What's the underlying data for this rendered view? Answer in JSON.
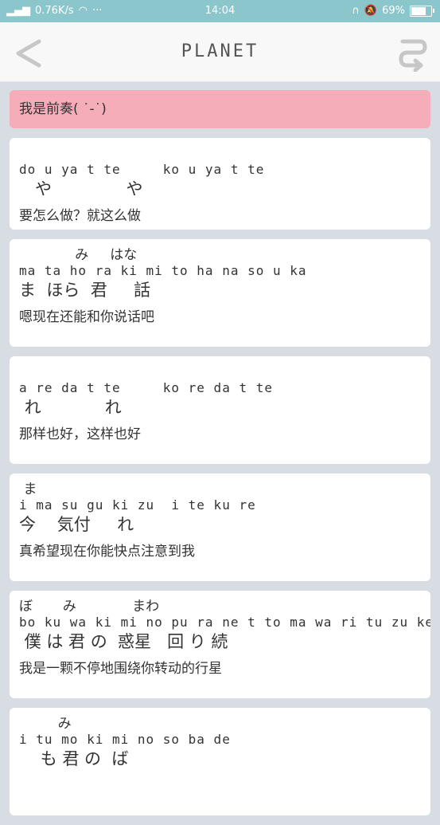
{
  "statusbar": {
    "network": "0.76K/s",
    "dots": "···",
    "time": "14:04",
    "battery": "69%"
  },
  "header": {
    "title": "PLANET"
  },
  "prelude": "我是前奏( ˙-˙)",
  "cards": [
    {
      "furigana": "",
      "romaji": "do u ya t te     ko u ya t te",
      "kanji": "   や              や",
      "chinese": "要怎么做？就这么做"
    },
    {
      "furigana": "             み     はな",
      "romaji": "ma ta ho ra ki mi to ha na so u ka",
      "kanji": "ま  ほら  君     話",
      "chinese": "嗯现在还能和你说话吧"
    },
    {
      "furigana": "",
      "romaji": "a re da t te     ko re da t te",
      "kanji": " れ            れ",
      "chinese": "那样也好，这样也好"
    },
    {
      "furigana": " ま",
      "romaji": "i ma su gu ki zu  i te ku re",
      "kanji": "今    気付     れ",
      "chinese": "真希望现在你能快点注意到我"
    },
    {
      "furigana": "ぼ       み             まわ",
      "romaji": "bo ku wa ki mi no pu ra ne t to ma wa ri tu zu ke te",
      "kanji": " 僕 は 君 の  惑星   回 り 続",
      "chinese": "我是一颗不停地围绕你转动的行星"
    },
    {
      "furigana": "         み",
      "romaji": "i tu mo ki mi no so ba de",
      "kanji": "    も 君 の  ば",
      "chinese": ""
    }
  ]
}
